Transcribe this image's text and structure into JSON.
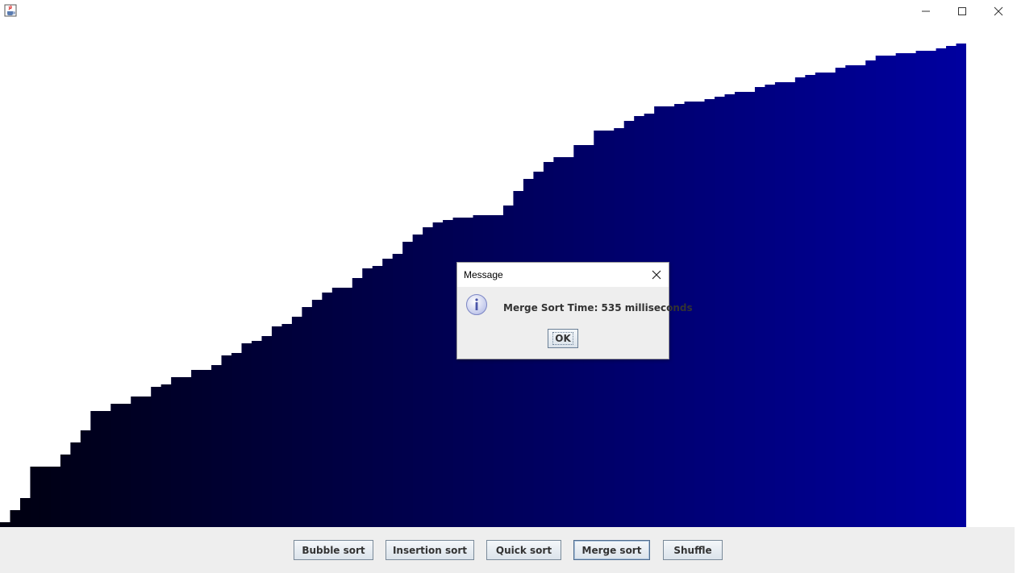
{
  "window": {
    "icon": "java-cup-icon",
    "controls": [
      "minimize-icon",
      "maximize-icon",
      "close-icon"
    ]
  },
  "chart_data": {
    "type": "bar",
    "description_colors": {
      "start": "#000010",
      "end": "#00009f"
    },
    "values": [
      2,
      7,
      12,
      25,
      25,
      25,
      30,
      35,
      40,
      48,
      48,
      51,
      51,
      54,
      54,
      58,
      59,
      62,
      62,
      65,
      65,
      67,
      71,
      72,
      76,
      77,
      79,
      83,
      84,
      87,
      91,
      94,
      97,
      99,
      99,
      103,
      107,
      108,
      111,
      113,
      118,
      121,
      124,
      126,
      127,
      128,
      128,
      129,
      129,
      129,
      133,
      139,
      144,
      147,
      151,
      153,
      153,
      158,
      158,
      164,
      164,
      165,
      168,
      170,
      171,
      174,
      174,
      175,
      176,
      176,
      177,
      178,
      179,
      180,
      180,
      182,
      183,
      184,
      184,
      186,
      187,
      188,
      188,
      190,
      191,
      191,
      193,
      195,
      195,
      196,
      196,
      197,
      197,
      198,
      199,
      200
    ]
  },
  "dialog": {
    "title": "Message",
    "message": "Merge Sort Time: 535 milliseconds",
    "ok_label": "OK"
  },
  "buttons": {
    "bubble": "Bubble sort",
    "insertion": "Insertion sort",
    "quick": "Quick sort",
    "merge": "Merge sort",
    "shuffle": "Shuffle"
  }
}
